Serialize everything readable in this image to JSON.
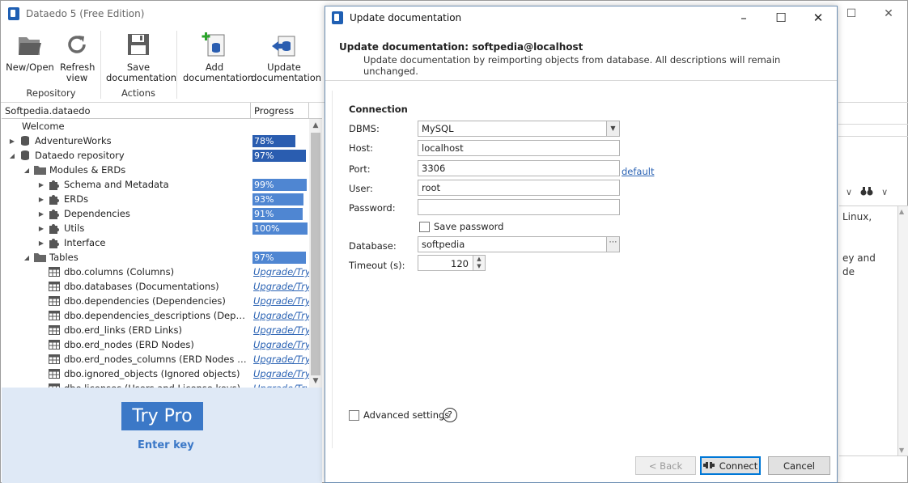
{
  "main_window": {
    "title": "Dataedo 5 (Free Edition)",
    "controls": [
      "–",
      "☐",
      "✕"
    ]
  },
  "ribbon": {
    "buttons": {
      "new_open": "New/Open",
      "refresh": "Refresh view",
      "save": "Save documentation",
      "add": "Add documentation",
      "update": "Update documentation"
    },
    "groups": {
      "repository": "Repository",
      "actions": "Actions"
    }
  },
  "tree": {
    "header": {
      "name": "Softpedia.dataedo",
      "progress": "Progress"
    },
    "items": [
      {
        "label": "Welcome",
        "level": 0,
        "expander": "",
        "icon": "welcome",
        "progress": null
      },
      {
        "label": "AdventureWorks",
        "level": 0,
        "expander": "▶",
        "icon": "db",
        "progress": "78%",
        "pct": 78
      },
      {
        "label": "Dataedo repository",
        "level": 0,
        "expander": "◢",
        "icon": "db",
        "progress": "97%",
        "pct": 97
      },
      {
        "label": "Modules & ERDs",
        "level": 1,
        "expander": "◢",
        "icon": "folder",
        "progress": null
      },
      {
        "label": "Schema and Metadata",
        "level": 2,
        "expander": "▶",
        "icon": "puzzle",
        "progress": "99%",
        "pct": 99
      },
      {
        "label": "ERDs",
        "level": 2,
        "expander": "▶",
        "icon": "puzzle",
        "progress": "93%",
        "pct": 93
      },
      {
        "label": "Dependencies",
        "level": 2,
        "expander": "▶",
        "icon": "puzzle",
        "progress": "91%",
        "pct": 91
      },
      {
        "label": "Utils",
        "level": 2,
        "expander": "▶",
        "icon": "puzzle",
        "progress": "100%",
        "pct": 100
      },
      {
        "label": "Interface",
        "level": 2,
        "expander": "▶",
        "icon": "puzzle",
        "progress": null
      },
      {
        "label": "Tables",
        "level": 1,
        "expander": "◢",
        "icon": "folder",
        "progress": "97%",
        "pct": 97
      },
      {
        "label": "dbo.columns (Columns)",
        "level": 2,
        "expander": "",
        "icon": "table",
        "upgrade": "Upgrade/Try"
      },
      {
        "label": "dbo.databases (Documentations)",
        "level": 2,
        "expander": "",
        "icon": "table",
        "upgrade": "Upgrade/Try"
      },
      {
        "label": "dbo.dependencies (Dependencies)",
        "level": 2,
        "expander": "",
        "icon": "table",
        "upgrade": "Upgrade/Try"
      },
      {
        "label": "dbo.dependencies_descriptions (Dependenci...",
        "level": 2,
        "expander": "",
        "icon": "table",
        "upgrade": "Upgrade/Try"
      },
      {
        "label": "dbo.erd_links (ERD Links)",
        "level": 2,
        "expander": "",
        "icon": "table",
        "upgrade": "Upgrade/Try"
      },
      {
        "label": "dbo.erd_nodes (ERD Nodes)",
        "level": 2,
        "expander": "",
        "icon": "table",
        "upgrade": "Upgrade/Try"
      },
      {
        "label": "dbo.erd_nodes_columns (ERD Nodes Columns)",
        "level": 2,
        "expander": "",
        "icon": "table",
        "upgrade": "Upgrade/Try"
      },
      {
        "label": "dbo.ignored_objects (Ignored objects)",
        "level": 2,
        "expander": "",
        "icon": "table",
        "upgrade": "Upgrade/Try"
      },
      {
        "label": "dbo.licenses (Users and License keys)",
        "level": 2,
        "expander": "",
        "icon": "table",
        "upgrade": "Upgrade/Try"
      }
    ]
  },
  "promo": {
    "try_pro": "Try Pro",
    "enter_key": "Enter key"
  },
  "right_panel": {
    "text_lines": [
      "Linux,",
      "",
      "",
      "ey and",
      "de"
    ]
  },
  "dialog": {
    "title": "Update documentation",
    "controls": [
      "–",
      "☐",
      "✕"
    ],
    "heading": "Update documentation: softpedia@localhost",
    "subheading": "Update documentation by reimporting objects from database. All descriptions will remain unchanged.",
    "section": "Connection",
    "fields": {
      "dbms": {
        "label": "DBMS:",
        "value": "MySQL"
      },
      "host": {
        "label": "Host:",
        "value": "localhost"
      },
      "port": {
        "label": "Port:",
        "value": "3306",
        "link": "default"
      },
      "user": {
        "label": "User:",
        "value": "root"
      },
      "password": {
        "label": "Password:",
        "value": ""
      },
      "save_password": {
        "label": "Save password",
        "checked": false
      },
      "database": {
        "label": "Database:",
        "value": "softpedia"
      },
      "timeout": {
        "label": "Timeout (s):",
        "value": "120"
      }
    },
    "advanced_settings": "Advanced settings",
    "help": "?",
    "buttons": {
      "back": "< Back",
      "connect": "Connect",
      "cancel": "Cancel"
    }
  },
  "colors": {
    "progress_dark": "#2a5db0",
    "progress_light": "#4f86d2",
    "accent": "#3b78c7",
    "link": "#2b63b4",
    "promo_bg": "#dfe9f6"
  }
}
